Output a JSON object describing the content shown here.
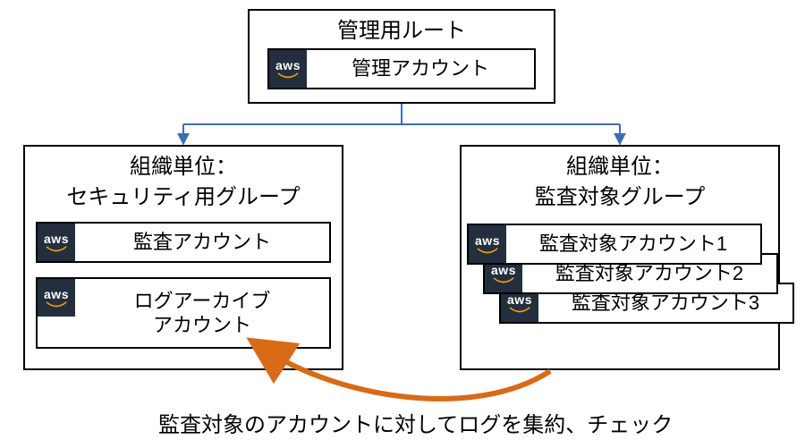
{
  "root": {
    "title": "管理用ルート",
    "account": "管理アカウント"
  },
  "ou_left": {
    "title_line1": "組織単位：",
    "title_line2": "セキュリティ用グループ",
    "accounts": {
      "audit": "監査アカウント",
      "log_line1": "ログアーカイブ",
      "log_line2": "アカウント"
    }
  },
  "ou_right": {
    "title_line1": "組織単位：",
    "title_line2": "監査対象グループ",
    "accounts": {
      "a1": "監査対象アカウント1",
      "a2": "監査対象アカウント2",
      "a3": "監査対象アカウント3"
    }
  },
  "aws_label": "aws",
  "caption": "監査対象のアカウントに対してログを集約、チェック",
  "colors": {
    "connector": "#3b6fb5",
    "curve": "#d96b16"
  }
}
